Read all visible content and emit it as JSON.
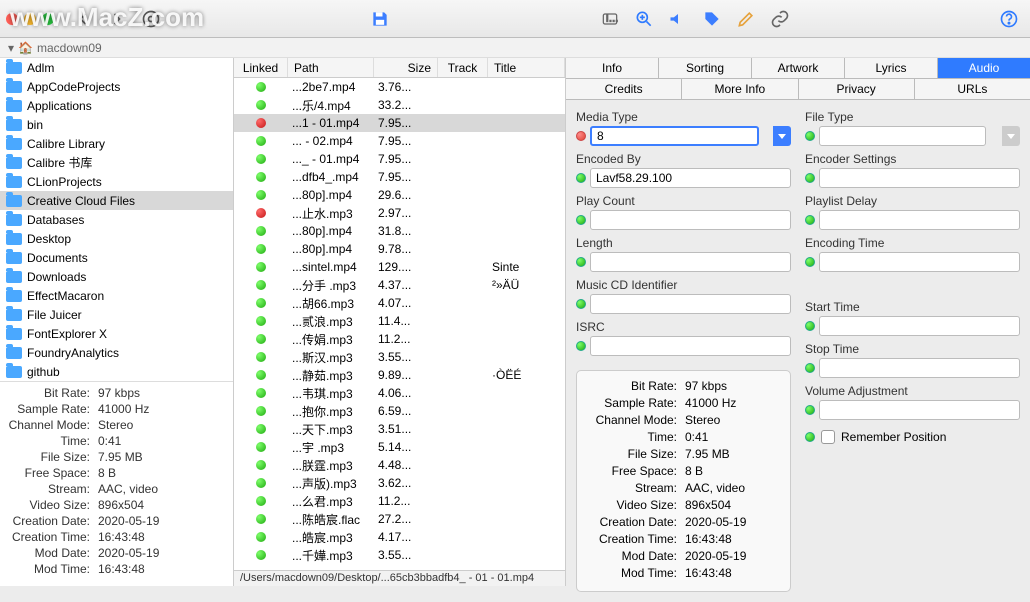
{
  "watermark": "www.MacZ.com",
  "breadcrumb": {
    "user": "macdown09"
  },
  "sidebar": {
    "folders": [
      {
        "name": "Adlm"
      },
      {
        "name": "AppCodeProjects"
      },
      {
        "name": "Applications"
      },
      {
        "name": "bin"
      },
      {
        "name": "Calibre Library"
      },
      {
        "name": "Calibre 书库"
      },
      {
        "name": "CLionProjects"
      },
      {
        "name": "Creative Cloud Files",
        "selected": true
      },
      {
        "name": "Databases"
      },
      {
        "name": "Desktop"
      },
      {
        "name": "Documents"
      },
      {
        "name": "Downloads"
      },
      {
        "name": "EffectMacaron"
      },
      {
        "name": "File Juicer"
      },
      {
        "name": "FontExplorer X"
      },
      {
        "name": "FoundryAnalytics"
      },
      {
        "name": "github"
      }
    ],
    "info": [
      {
        "label": "Bit Rate:",
        "value": "97 kbps"
      },
      {
        "label": "Sample Rate:",
        "value": "41000 Hz"
      },
      {
        "label": "Channel Mode:",
        "value": "Stereo"
      },
      {
        "label": "Time:",
        "value": "0:41"
      },
      {
        "label": "File Size:",
        "value": "7.95 MB"
      },
      {
        "label": "Free Space:",
        "value": "8 B"
      },
      {
        "label": "Stream:",
        "value": "AAC, video"
      },
      {
        "label": "Video Size:",
        "value": "896x504"
      },
      {
        "label": "Creation Date:",
        "value": "2020-05-19"
      },
      {
        "label": "Creation Time:",
        "value": "16:43:48"
      },
      {
        "label": "Mod Date:",
        "value": "2020-05-19"
      },
      {
        "label": "Mod Time:",
        "value": "16:43:48"
      }
    ]
  },
  "filelist": {
    "headers": {
      "linked": "Linked",
      "path": "Path",
      "size": "Size",
      "track": "Track",
      "title": "Title"
    },
    "rows": [
      {
        "led": "g",
        "path": "...2be7.mp4",
        "size": "3.76...",
        "title": ""
      },
      {
        "led": "g",
        "path": "...乐/4.mp4",
        "size": "33.2...",
        "title": ""
      },
      {
        "led": "r",
        "path": "...1 - 01.mp4",
        "size": "7.95...",
        "title": "",
        "selected": true
      },
      {
        "led": "g",
        "path": "... - 02.mp4",
        "size": "7.95...",
        "title": ""
      },
      {
        "led": "g",
        "path": "..._ - 01.mp4",
        "size": "7.95...",
        "title": ""
      },
      {
        "led": "g",
        "path": "...dfb4_.mp4",
        "size": "7.95...",
        "title": ""
      },
      {
        "led": "g",
        "path": "...80p].mp4",
        "size": "29.6...",
        "title": ""
      },
      {
        "led": "r",
        "path": "...止水.mp3",
        "size": "2.97...",
        "title": ""
      },
      {
        "led": "g",
        "path": "...80p].mp4",
        "size": "31.8...",
        "title": ""
      },
      {
        "led": "g",
        "path": "...80p].mp4",
        "size": "9.78...",
        "title": ""
      },
      {
        "led": "g",
        "path": "...sintel.mp4",
        "size": "129....",
        "title": "Sinte"
      },
      {
        "led": "g",
        "path": "...分手 .mp3",
        "size": "4.37...",
        "title": "²»ÄÜ"
      },
      {
        "led": "g",
        "path": "...胡66.mp3",
        "size": "4.07...",
        "title": ""
      },
      {
        "led": "g",
        "path": "...贰浪.mp3",
        "size": "11.4...",
        "title": ""
      },
      {
        "led": "g",
        "path": "...传娟.mp3",
        "size": "11.2...",
        "title": ""
      },
      {
        "led": "g",
        "path": "...斯汉.mp3",
        "size": "3.55...",
        "title": ""
      },
      {
        "led": "g",
        "path": "...静茹.mp3",
        "size": "9.89...",
        "title": "·ÒËÉ"
      },
      {
        "led": "g",
        "path": "...韦琪.mp3",
        "size": "4.06...",
        "title": ""
      },
      {
        "led": "g",
        "path": "...抱你.mp3",
        "size": "6.59...",
        "title": ""
      },
      {
        "led": "g",
        "path": "...天下.mp3",
        "size": "3.51...",
        "title": ""
      },
      {
        "led": "g",
        "path": "...宇 .mp3",
        "size": "5.14...",
        "title": ""
      },
      {
        "led": "g",
        "path": "...朕霆.mp3",
        "size": "4.48...",
        "title": ""
      },
      {
        "led": "g",
        "path": "...声版).mp3",
        "size": "3.62...",
        "title": ""
      },
      {
        "led": "g",
        "path": "...么君.mp3",
        "size": "11.2...",
        "title": ""
      },
      {
        "led": "g",
        "path": "...陈皓宸.flac",
        "size": "27.2...",
        "title": ""
      },
      {
        "led": "g",
        "path": "...皓宸.mp3",
        "size": "4.17...",
        "title": ""
      },
      {
        "led": "g",
        "path": "...千嬅.mp3",
        "size": "3.55...",
        "title": ""
      }
    ],
    "status": "/Users/macdown09/Desktop/...65cb3bbadfb4_ - 01 - 01.mp4"
  },
  "tabs1": [
    "Info",
    "Sorting",
    "Artwork",
    "Lyrics",
    "Audio"
  ],
  "tabs1_active": 4,
  "tabs2": [
    "Credits",
    "More Info",
    "Privacy",
    "URLs"
  ],
  "form": {
    "left": {
      "media_type": {
        "label": "Media Type",
        "value": "8",
        "led": "r"
      },
      "encoded_by": {
        "label": "Encoded By",
        "value": "Lavf58.29.100",
        "led": "g"
      },
      "play_count": {
        "label": "Play Count",
        "value": "",
        "led": "g"
      },
      "length": {
        "label": "Length",
        "value": "",
        "led": "g"
      },
      "music_cd": {
        "label": "Music CD Identifier",
        "value": "",
        "led": "g"
      },
      "isrc": {
        "label": "ISRC",
        "value": "",
        "led": "g"
      }
    },
    "right": {
      "file_type": {
        "label": "File Type",
        "value": "",
        "led": "g"
      },
      "encoder_settings": {
        "label": "Encoder Settings",
        "value": "",
        "led": "g"
      },
      "playlist_delay": {
        "label": "Playlist Delay",
        "value": "",
        "led": "g"
      },
      "encoding_time": {
        "label": "Encoding Time",
        "value": "",
        "led": "g"
      },
      "start_time": {
        "label": "Start Time",
        "value": "",
        "led": "g"
      },
      "stop_time": {
        "label": "Stop Time",
        "value": "",
        "led": "g"
      },
      "volume_adj": {
        "label": "Volume Adjustment",
        "value": "",
        "led": "g"
      },
      "remember": {
        "label": "Remember Position",
        "led": "g"
      }
    },
    "infobox": [
      {
        "label": "Bit Rate:",
        "value": "97 kbps"
      },
      {
        "label": "Sample Rate:",
        "value": "41000 Hz"
      },
      {
        "label": "Channel Mode:",
        "value": "Stereo"
      },
      {
        "label": "Time:",
        "value": "0:41"
      },
      {
        "label": "File Size:",
        "value": "7.95 MB"
      },
      {
        "label": "Free Space:",
        "value": "8 B"
      },
      {
        "label": "Stream:",
        "value": "AAC, video"
      },
      {
        "label": "Video Size:",
        "value": "896x504"
      },
      {
        "label": "Creation Date:",
        "value": "2020-05-19"
      },
      {
        "label": "Creation Time:",
        "value": "16:43:48"
      },
      {
        "label": "Mod Date:",
        "value": "2020-05-19"
      },
      {
        "label": "Mod Time:",
        "value": "16:43:48"
      }
    ]
  }
}
